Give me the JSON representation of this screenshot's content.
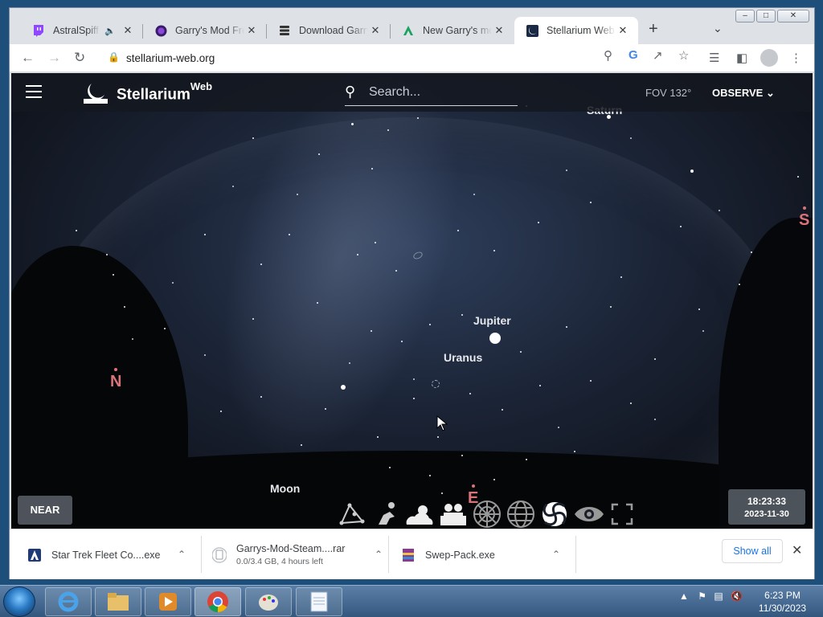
{
  "browser": {
    "tabs": [
      {
        "title": "AstralSpiff - T",
        "favicon": "twitch-icon",
        "audio": true
      },
      {
        "title": "Garry's Mod Free",
        "favicon": "gmod-icon"
      },
      {
        "title": "Download Garry's",
        "favicon": "stack-icon"
      },
      {
        "title": "New Garry's mod",
        "favicon": "a-logo-icon"
      },
      {
        "title": "Stellarium Web O",
        "favicon": "stellarium-icon",
        "active": true
      }
    ],
    "url": "stellarium-web.org"
  },
  "app": {
    "brand": "Stellarium",
    "brand_sup": "Web",
    "search_placeholder": "Search...",
    "fov": "FOV 132°",
    "observe_label": "OBSERVE",
    "near_label": "NEAR",
    "time": "18:23:33",
    "date": "2023-11-30"
  },
  "sky_labels": {
    "saturn": "Saturn",
    "jupiter": "Jupiter",
    "uranus": "Uranus",
    "moon": "Moon",
    "north": "N",
    "south": "S",
    "east": "E"
  },
  "downloads": {
    "items": [
      {
        "name": "Star Trek Fleet Co....exe",
        "icon": "app-icon"
      },
      {
        "name": "Garrys-Mod-Steam....rar",
        "status": "0.0/3.4 GB, 4 hours left",
        "icon": "file-icon"
      },
      {
        "name": "Swep-Pack.exe",
        "icon": "archive-icon"
      }
    ],
    "show_all": "Show all"
  },
  "taskbar": {
    "clock_time": "6:23 PM",
    "clock_date": "11/30/2023"
  }
}
